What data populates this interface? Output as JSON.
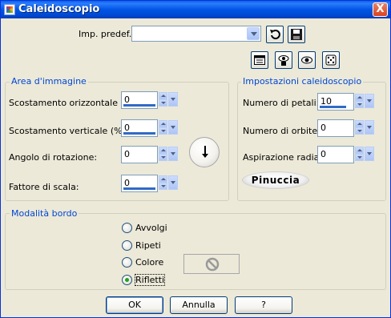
{
  "window": {
    "title": "Caleidoscopio",
    "close_glyph": "X"
  },
  "presets": {
    "label": "Imp. predef.:",
    "value": ""
  },
  "toolbar_icons": [
    "undo-icon",
    "save-icon",
    "window-icon",
    "eye-lock-icon",
    "eye-icon",
    "dice-icon"
  ],
  "image_area": {
    "title": "Area d'immagine",
    "fields": [
      {
        "label": "Scostamento orizzontale (%):",
        "value": "0"
      },
      {
        "label": "Scostamento verticale (%):",
        "value": "0"
      },
      {
        "label": "Angolo di rotazione:",
        "value": "0"
      },
      {
        "label": "Fattore di scala:",
        "value": "0"
      }
    ]
  },
  "kaleido_settings": {
    "title": "Impostazioni caleidoscopio",
    "fields": [
      {
        "label": "Numero di petali:",
        "value": "10"
      },
      {
        "label": "Numero di orbite:",
        "value": "0"
      },
      {
        "label": "Aspirazione radiale:",
        "value": "0"
      }
    ],
    "logo_text": "Pinuccia"
  },
  "edge_mode": {
    "title": "Modalità bordo",
    "options": [
      {
        "label": "Avvolgi",
        "checked": false
      },
      {
        "label": "Ripeti",
        "checked": false
      },
      {
        "label": "Colore",
        "checked": false
      },
      {
        "label": "Rifletti",
        "checked": true
      }
    ],
    "color_swatch_icon": "no-symbol-icon"
  },
  "buttons": {
    "ok": "OK",
    "cancel": "Annulla",
    "help": "?"
  }
}
